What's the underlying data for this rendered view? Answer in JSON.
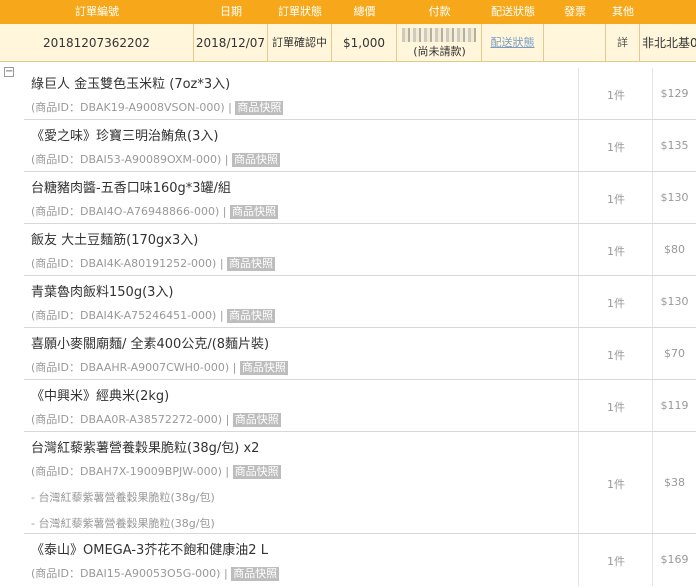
{
  "header": {
    "columns": [
      "訂單編號",
      "日期",
      "訂單狀態",
      "總價",
      "付款",
      "配送狀態",
      "發票",
      "其他"
    ],
    "order": {
      "number": "20181207362202",
      "date": "2018/12/07",
      "status": "訂單確認中",
      "total": "$1,000",
      "payment_note": "(尚未請款)",
      "delivery_status": "配送狀態",
      "invoice": "",
      "other": "詳",
      "extra": "非北北基0"
    }
  },
  "toggle_symbol": "−",
  "items": [
    {
      "name": "綠巨人 金玉雙色玉米粒 (7oz*3入)",
      "id_text": "(商品ID：DBAK19-A9008VSON-000)",
      "snapshot": "商品快照",
      "qty": "1件",
      "price": "$129",
      "subs": []
    },
    {
      "name": "《愛之味》珍寶三明治鮪魚(3入)",
      "id_text": "(商品ID：DBAI53-A90089OXM-000)",
      "snapshot": "商品快照",
      "qty": "1件",
      "price": "$135",
      "subs": []
    },
    {
      "name": "台糖豬肉醬-五香口味160g*3罐/組",
      "id_text": "(商品ID：DBAI4O-A76948866-000)",
      "snapshot": "商品快照",
      "qty": "1件",
      "price": "$130",
      "subs": []
    },
    {
      "name": "飯友 大土豆麵筋(170gx3入)",
      "id_text": "(商品ID：DBAI4K-A80191252-000)",
      "snapshot": "商品快照",
      "qty": "1件",
      "price": "$80",
      "subs": []
    },
    {
      "name": "青葉魯肉飯料150g(3入)",
      "id_text": "(商品ID：DBAI4K-A75246451-000)",
      "snapshot": "商品快照",
      "qty": "1件",
      "price": "$130",
      "subs": []
    },
    {
      "name": "喜願小麥關廟麵/ 全素400公克/(8麵片裝)",
      "id_text": "(商品ID：DBAAHR-A9007CWH0-000)",
      "snapshot": "商品快照",
      "qty": "1件",
      "price": "$70",
      "subs": []
    },
    {
      "name": "《中興米》經典米(2kg)",
      "id_text": "(商品ID：DBAA0R-A38572272-000)",
      "snapshot": "商品快照",
      "qty": "1件",
      "price": "$119",
      "subs": []
    },
    {
      "name": "台灣紅藜紫薯營養穀果脆粒(38g/包) x2",
      "id_text": "(商品ID：DBAH7X-19009BPJW-000)",
      "snapshot": "商品快照",
      "qty": "1件",
      "price": "$38",
      "subs": [
        "- 台灣紅藜紫薯營養穀果脆粒(38g/包)",
        "- 台灣紅藜紫薯營養穀果脆粒(38g/包)"
      ]
    },
    {
      "name": "《泰山》OMEGA-3芥花不飽和健康油2 L",
      "id_text": "(商品ID：DBAI15-A90053O5G-000)",
      "snapshot": "商品快照",
      "qty": "1件",
      "price": "$169",
      "subs": []
    }
  ]
}
